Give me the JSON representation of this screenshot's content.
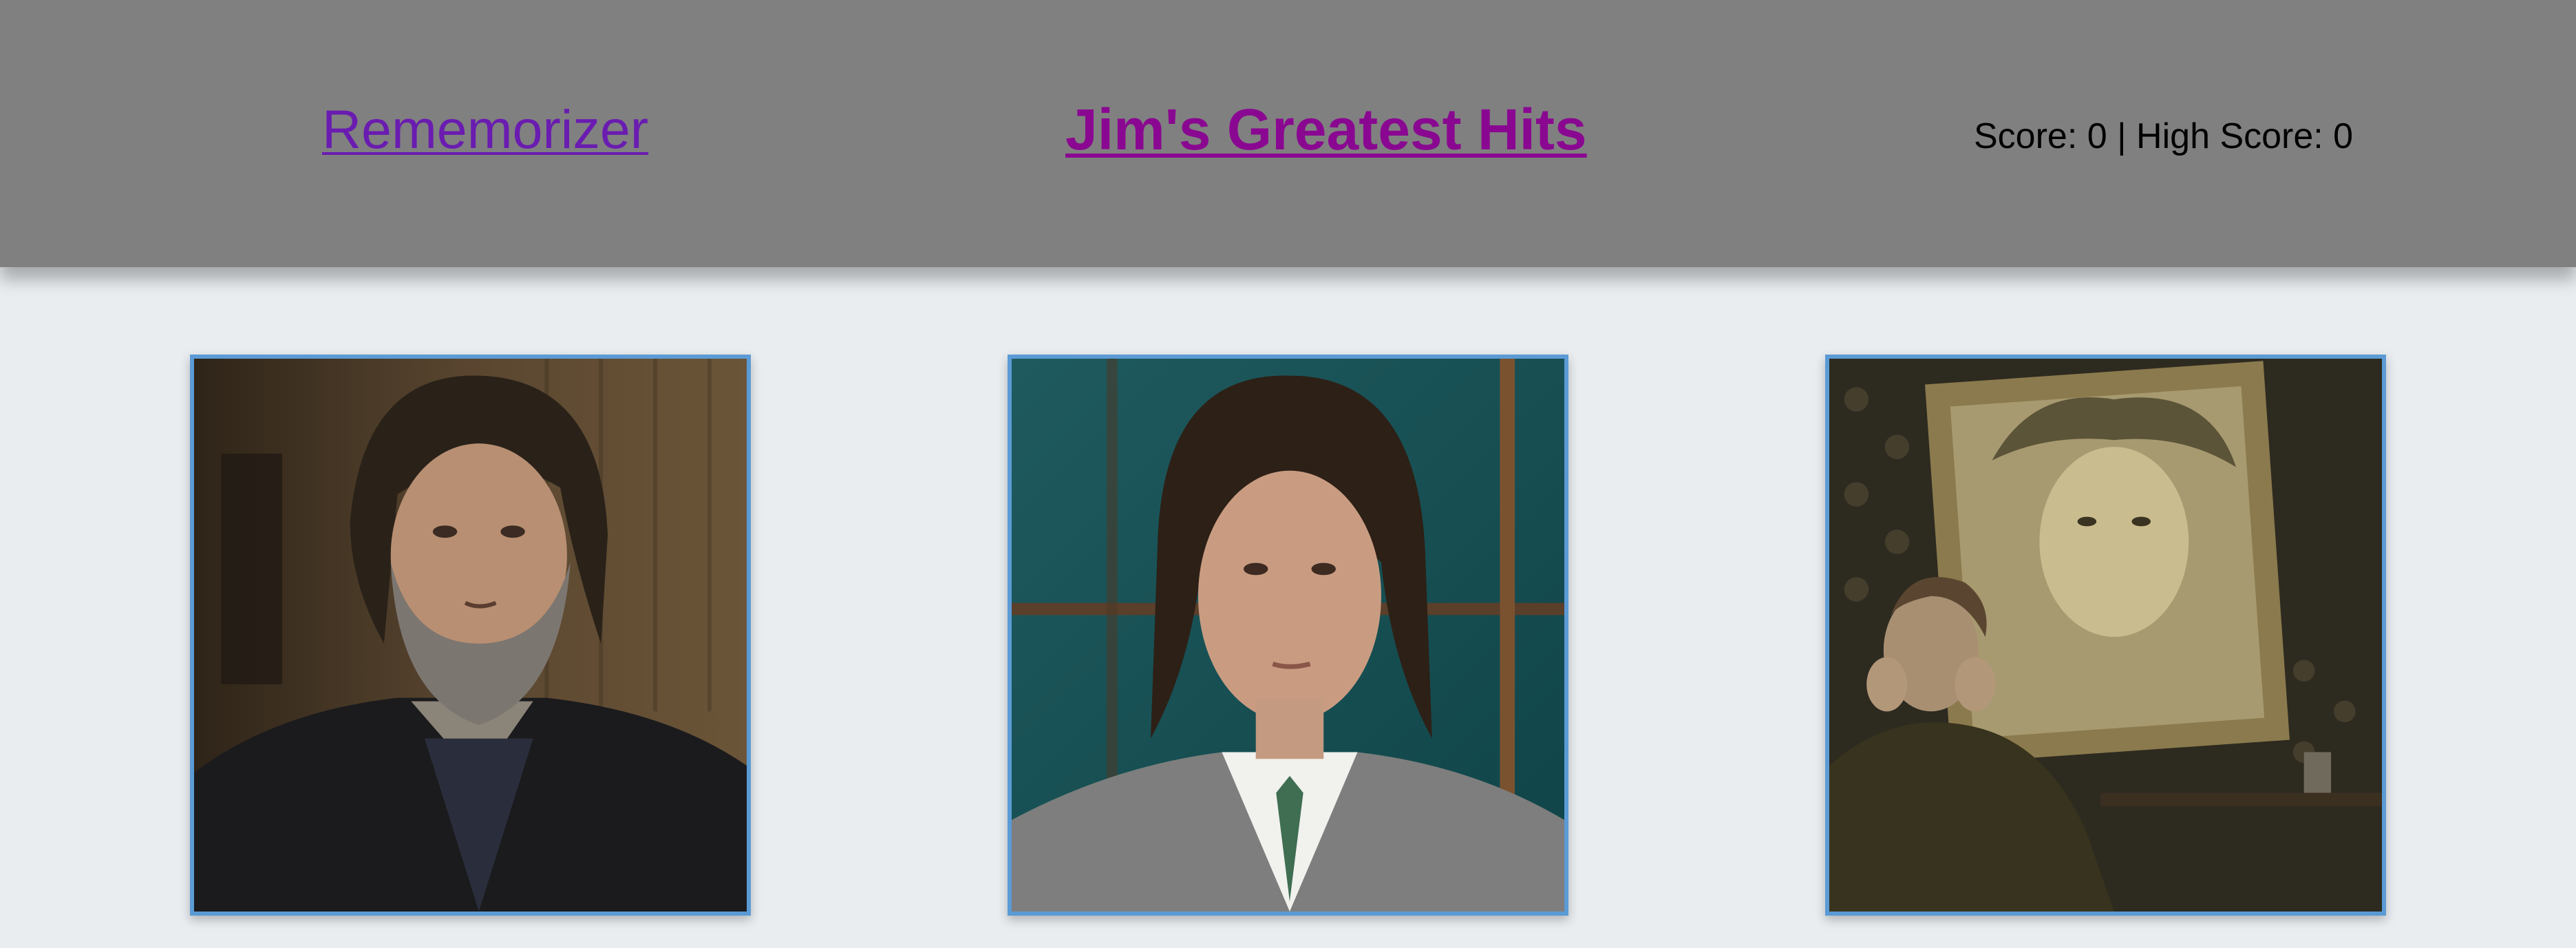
{
  "header": {
    "brand": "Rememorizer",
    "title": "Jim's Greatest Hits",
    "score_text": "Score: 0 | High Score: 0"
  },
  "cards": [
    {
      "subject": "bearded-man-portrait"
    },
    {
      "subject": "man-in-suit-portrait"
    },
    {
      "subject": "man-with-painting"
    }
  ],
  "colors": {
    "header_bg": "#808080",
    "page_bg": "#e9edf0",
    "brand_link": "#6a1cb0",
    "title_link": "#8a0891",
    "card_border": "#5b9bd5"
  }
}
